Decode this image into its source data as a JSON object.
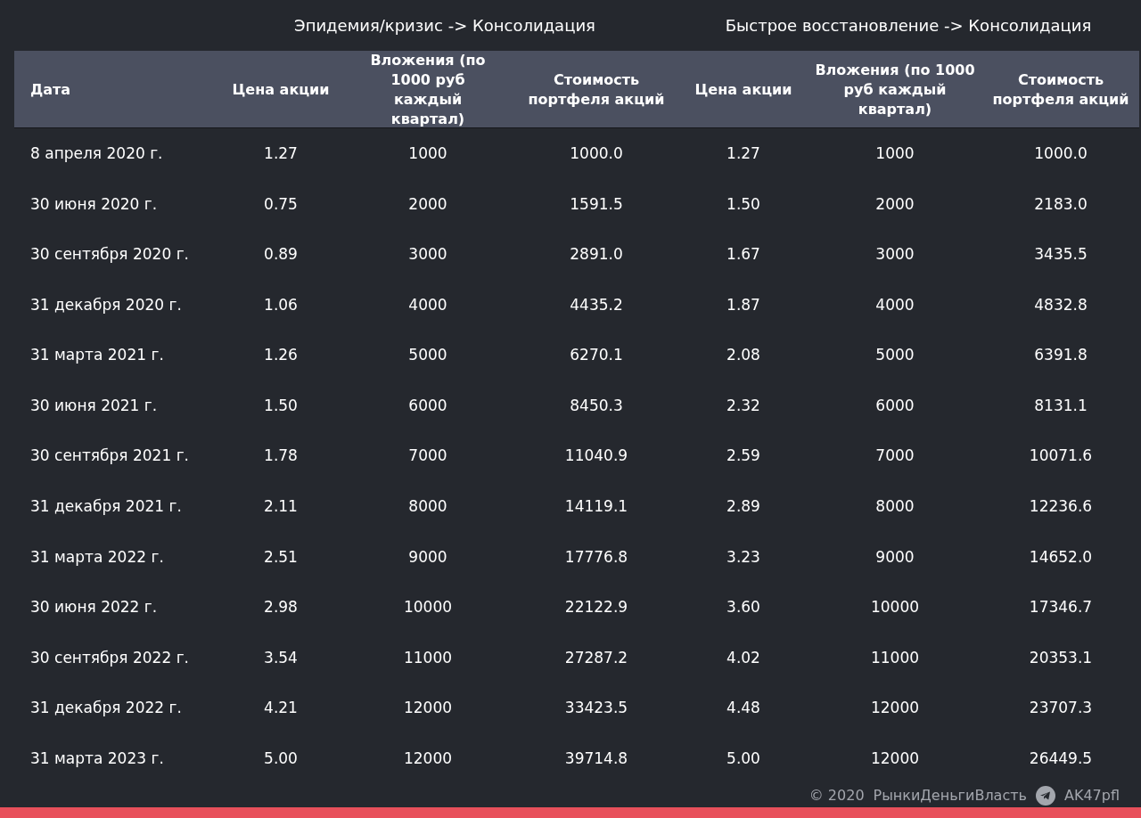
{
  "groups": [
    "Эпидемия/кризис -> Консолидация",
    "Быстрое восстановление -> Консолидация"
  ],
  "columns": [
    "Дата",
    "Цена акции",
    "Вложения (по 1000 руб каждый квартал)",
    "Стоимость портфеля акций",
    "Цена акции",
    "Вложения (по 1000 руб каждый квартал)",
    "Стоимость портфеля акций"
  ],
  "rows": [
    [
      "8 апреля 2020 г.",
      "1.27",
      "1000",
      "1000.0",
      "1.27",
      "1000",
      "1000.0"
    ],
    [
      "30 июня 2020 г.",
      "0.75",
      "2000",
      "1591.5",
      "1.50",
      "2000",
      "2183.0"
    ],
    [
      "30 сентября 2020 г.",
      "0.89",
      "3000",
      "2891.0",
      "1.67",
      "3000",
      "3435.5"
    ],
    [
      "31 декабря 2020 г.",
      "1.06",
      "4000",
      "4435.2",
      "1.87",
      "4000",
      "4832.8"
    ],
    [
      "31 марта 2021 г.",
      "1.26",
      "5000",
      "6270.1",
      "2.08",
      "5000",
      "6391.8"
    ],
    [
      "30 июня 2021 г.",
      "1.50",
      "6000",
      "8450.3",
      "2.32",
      "6000",
      "8131.1"
    ],
    [
      "30 сентября 2021 г.",
      "1.78",
      "7000",
      "11040.9",
      "2.59",
      "7000",
      "10071.6"
    ],
    [
      "31 декабря 2021 г.",
      "2.11",
      "8000",
      "14119.1",
      "2.89",
      "8000",
      "12236.6"
    ],
    [
      "31 марта 2022 г.",
      "2.51",
      "9000",
      "17776.8",
      "3.23",
      "9000",
      "14652.0"
    ],
    [
      "30 июня 2022 г.",
      "2.98",
      "10000",
      "22122.9",
      "3.60",
      "10000",
      "17346.7"
    ],
    [
      "30 сентября 2022 г.",
      "3.54",
      "11000",
      "27287.2",
      "4.02",
      "11000",
      "20353.1"
    ],
    [
      "31 декабря 2022 г.",
      "4.21",
      "12000",
      "33423.5",
      "4.48",
      "12000",
      "23707.3"
    ],
    [
      "31 марта 2023 г.",
      "5.00",
      "12000",
      "39714.8",
      "5.00",
      "12000",
      "26449.5"
    ]
  ],
  "footer": {
    "copyright": "© 2020",
    "brand": "РынкиДеньгиВласть",
    "channel": "AK47pfl"
  }
}
